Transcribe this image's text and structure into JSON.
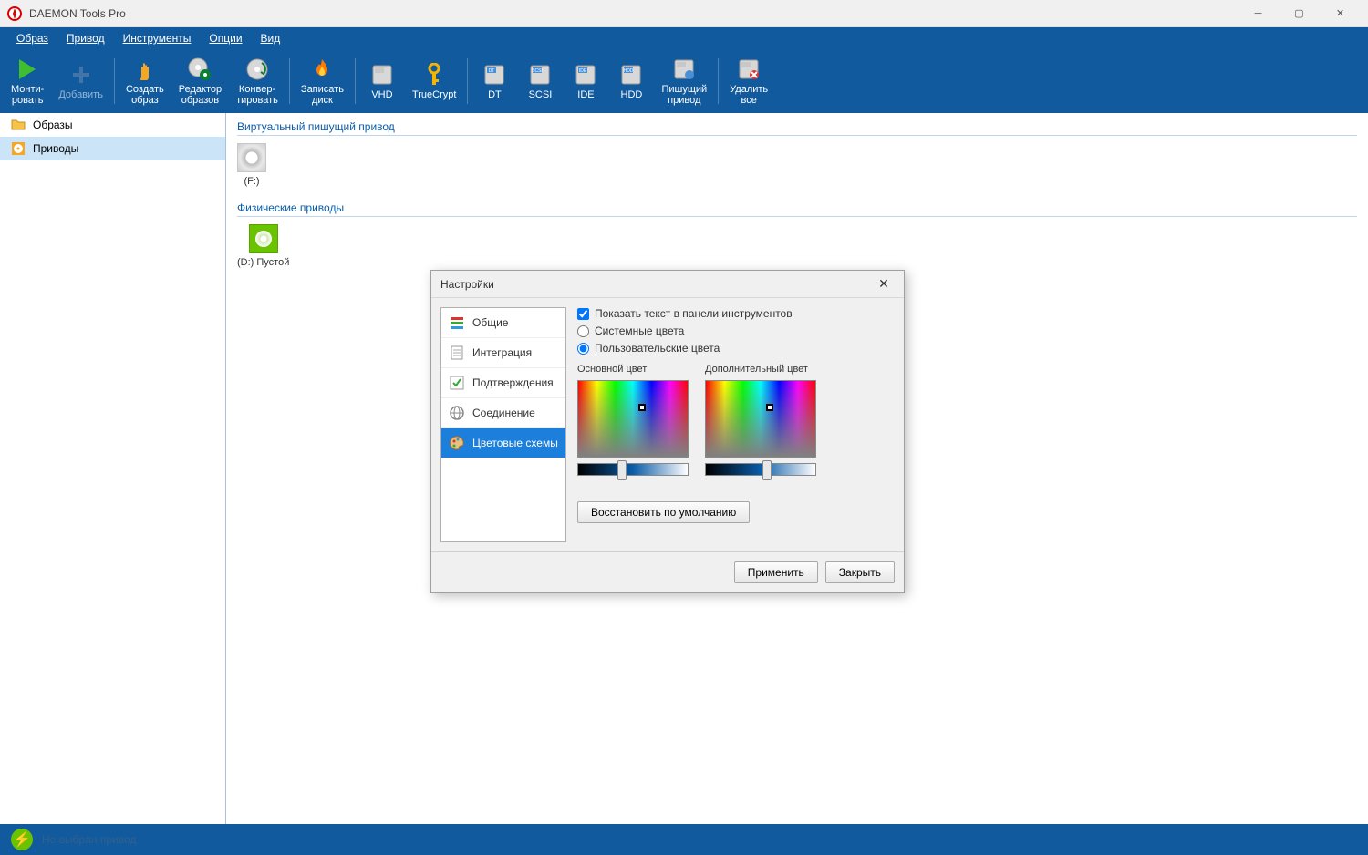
{
  "window": {
    "title": "DAEMON Tools Pro"
  },
  "menu": {
    "items": [
      "Образ",
      "Привод",
      "Инструменты",
      "Опции",
      "Вид"
    ]
  },
  "toolbar": {
    "groups": [
      [
        {
          "label": "Монти-\nровать",
          "icon": "play",
          "color": "#3fbf2f",
          "enabled": true
        },
        {
          "label": "Добавить",
          "icon": "plus",
          "color": "#fff",
          "enabled": false
        }
      ],
      [
        {
          "label": "Создать\nобраз",
          "icon": "hand",
          "color": "#f5a623",
          "enabled": true
        },
        {
          "label": "Редактор\nобразов",
          "icon": "disc-gear",
          "color": "#d5d5d5",
          "enabled": true
        },
        {
          "label": "Конвер-\nтировать",
          "icon": "disc-loop",
          "color": "#d5d5d5",
          "enabled": true
        }
      ],
      [
        {
          "label": "Записать\nдиск",
          "icon": "flame",
          "color": "#ff7b00",
          "enabled": true
        }
      ],
      [
        {
          "label": "VHD",
          "icon": "hdd",
          "color": "#c8c8c8",
          "enabled": true
        },
        {
          "label": "TrueCrypt",
          "icon": "key",
          "color": "#f5b400",
          "enabled": true
        }
      ],
      [
        {
          "label": "DT",
          "icon": "hdd-dt",
          "color": "#c8c8c8",
          "enabled": true
        },
        {
          "label": "SCSI",
          "icon": "hdd-scsi",
          "color": "#c8c8c8",
          "enabled": true
        },
        {
          "label": "IDE",
          "icon": "hdd-ide",
          "color": "#c8c8c8",
          "enabled": true
        },
        {
          "label": "HDD",
          "icon": "hdd-hdd",
          "color": "#c8c8c8",
          "enabled": true
        },
        {
          "label": "Пишущий\nпривод",
          "icon": "hdd-write",
          "color": "#c8c8c8",
          "enabled": true
        }
      ],
      [
        {
          "label": "Удалить\nвсе",
          "icon": "hdd-del",
          "color": "#c8c8c8",
          "enabled": true
        }
      ]
    ]
  },
  "sidebar": {
    "items": [
      {
        "label": "Образы",
        "icon": "folder",
        "selected": false
      },
      {
        "label": "Приводы",
        "icon": "disc",
        "selected": true
      }
    ]
  },
  "content": {
    "section1": {
      "title": "Виртуальный пишущий привод",
      "drive_label": "(F:)"
    },
    "section2": {
      "title": "Физические приводы",
      "drive_label": "(D:) Пустой"
    }
  },
  "statusbar": {
    "text": "Не выбран привод"
  },
  "dialog": {
    "title": "Настройки",
    "nav": [
      {
        "label": "Общие",
        "icon": "sliders"
      },
      {
        "label": "Интеграция",
        "icon": "doc"
      },
      {
        "label": "Подтверждения",
        "icon": "check"
      },
      {
        "label": "Соединение",
        "icon": "globe"
      },
      {
        "label": "Цветовые схемы",
        "icon": "palette",
        "active": true
      }
    ],
    "checkbox": {
      "label": "Показать текст в панели инструментов",
      "checked": true
    },
    "radio_system": {
      "label": "Системные цвета",
      "checked": false
    },
    "radio_custom": {
      "label": "Пользовательские цвета",
      "checked": true
    },
    "color_primary_label": "Основной цвет",
    "color_secondary_label": "Дополнительный цвет",
    "restore_label": "Восстановить по умолчанию",
    "apply_label": "Применить",
    "close_label": "Закрыть"
  }
}
